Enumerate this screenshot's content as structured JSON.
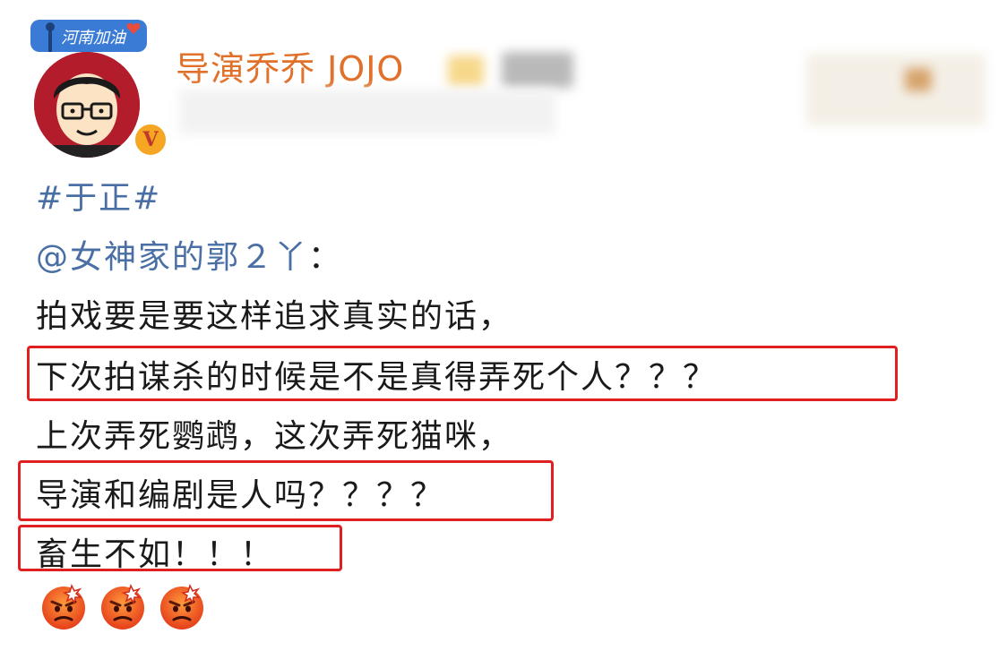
{
  "post": {
    "author": "导演乔乔 JOJO",
    "avatar_badge_text": "河南加油",
    "verified_badge": "V",
    "hashtag": "#于正#",
    "mention": "@女神家的郭２丫",
    "mention_colon": "：",
    "lines": [
      "拍戏要是要这样追求真实的话，",
      "下次拍谋杀的时候是不是真得弄死个人？？？",
      "上次弄死鹦鹉，这次弄死猫咪，",
      "导演和编剧是人吗？？？？",
      "畜生不如！！！"
    ],
    "emojis": [
      "angry-face-icon",
      "angry-face-icon",
      "angry-face-icon"
    ]
  },
  "colors": {
    "username": "#e0702a",
    "link": "#4a6fa5",
    "highlight_box": "#e02020",
    "text": "#1a1a1a"
  }
}
